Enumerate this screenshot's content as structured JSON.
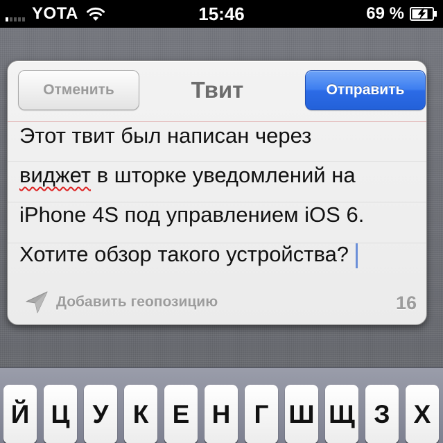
{
  "status_bar": {
    "carrier": "YOTA",
    "time": "15:46",
    "battery_percent": "69 %",
    "signal_strength": {
      "filled": 1,
      "total": 5
    }
  },
  "tweet_sheet": {
    "title": "Твит",
    "cancel_label": "Отменить",
    "send_label": "Отправить",
    "text_lines": [
      "Этот твит был написан через",
      "в шторке уведомлений на",
      "iPhone 4S под управлением iOS 6.",
      "Хотите обзор такого устройства?"
    ],
    "misspelled_word": "виджет",
    "add_location_label": "Добавить геопозицию",
    "char_count": "16",
    "send_color": "#2f6fe8"
  },
  "keyboard": {
    "keys": [
      "Й",
      "Ц",
      "У",
      "К",
      "Е",
      "Н",
      "Г",
      "Ш",
      "Щ",
      "З",
      "Х"
    ]
  }
}
